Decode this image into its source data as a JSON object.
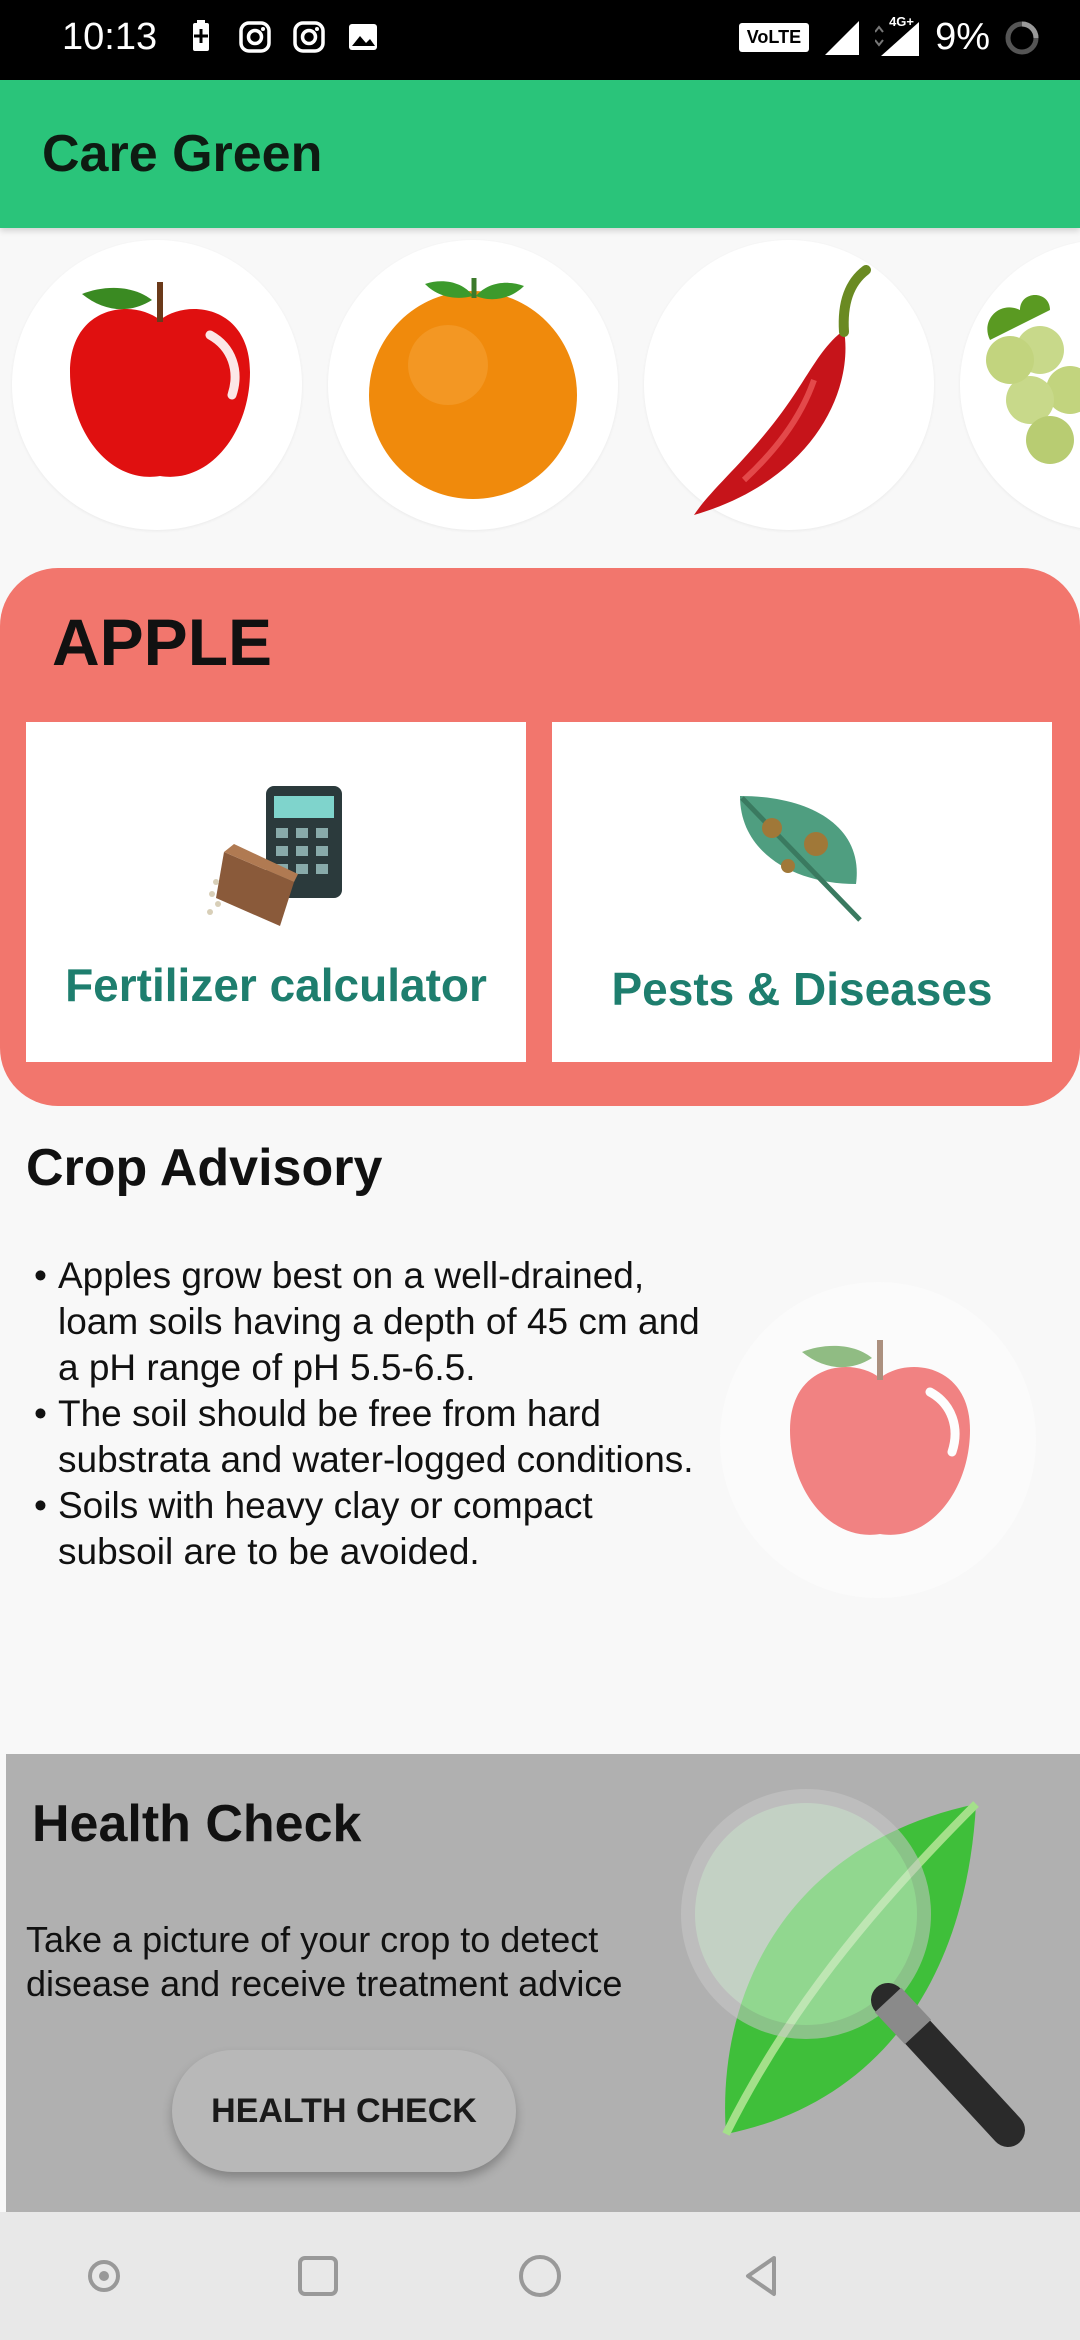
{
  "status_bar": {
    "time": "10:13",
    "volte": "VoLTE",
    "network": "4G+",
    "battery": "9%",
    "icons": [
      "battery-saver-icon",
      "instagram-icon",
      "instagram-icon",
      "gallery-icon",
      "signal-icon",
      "signal-4g-icon",
      "loading-icon"
    ]
  },
  "app_bar": {
    "title": "Care Green"
  },
  "crops": [
    {
      "name": "apple",
      "icon": "apple-icon"
    },
    {
      "name": "orange",
      "icon": "orange-icon"
    },
    {
      "name": "chilli",
      "icon": "chilli-icon"
    },
    {
      "name": "grapes",
      "icon": "grapes-icon"
    }
  ],
  "selected_crop": {
    "name": "APPLE",
    "tiles": [
      {
        "label": "Fertilizer calculator",
        "icon": "fertilizer-calculator-icon"
      },
      {
        "label": "Pests & Diseases",
        "icon": "leaf-disease-icon"
      }
    ]
  },
  "advisory": {
    "title": "Crop Advisory",
    "items": [
      "Apples grow best on a well-drained, loam soils having a depth of 45 cm and a pH range of pH 5.5-6.5.",
      "The soil should be free from hard substrata and water-logged conditions.",
      "Soils with heavy clay or compact subsoil are to be avoided."
    ]
  },
  "health_check": {
    "title": "Health Check",
    "description": "Take a picture of your crop to detect disease and receive treatment advice",
    "button_label": "HEALTH CHECK"
  },
  "nav_bar": {
    "buttons": [
      "dot-icon",
      "recents-icon",
      "home-icon",
      "back-icon"
    ]
  },
  "colors": {
    "app_bar": "#2ac47a",
    "crop_panel": "#f2766d",
    "tile_text": "#1e7e6e",
    "health_bg": "#b0b0b0"
  }
}
